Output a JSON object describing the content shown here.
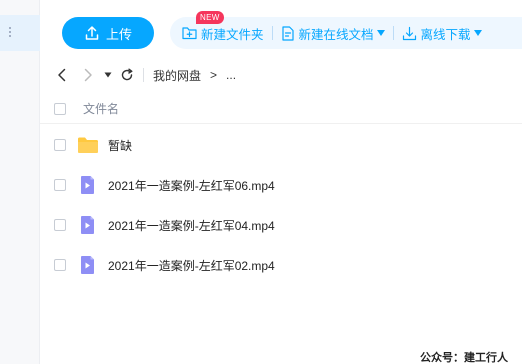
{
  "toolbar": {
    "upload_label": "上传",
    "new_folder_label": "新建文件夹",
    "new_online_doc_label": "新建在线文档",
    "new_badge": "NEW",
    "offline_download_label": "离线下载"
  },
  "breadcrumb": {
    "root": "我的网盘",
    "separator": ">",
    "ellipsis": "..."
  },
  "file_list": {
    "header_label": "文件名",
    "items": [
      {
        "type": "folder",
        "name": "暂缺"
      },
      {
        "type": "video",
        "name": "2021年一造案例-左红军06.mp4"
      },
      {
        "type": "video",
        "name": "2021年一造案例-左红军04.mp4"
      },
      {
        "type": "video",
        "name": "2021年一造案例-左红军02.mp4"
      }
    ]
  },
  "watermark": "公众号：建工行人",
  "colors": {
    "accent": "#06a7ff",
    "toolbar_bg": "#eef7ff",
    "folder": "#ffc940",
    "video_icon": "#8e8ef5",
    "badge": "#f5365c"
  }
}
